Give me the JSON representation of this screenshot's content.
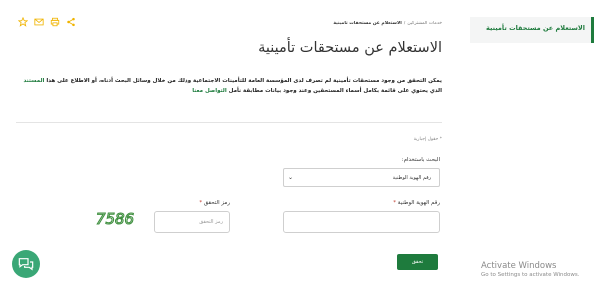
{
  "side_nav": {
    "active_item": "الاستعلام عن مستحقات تأمينية"
  },
  "breadcrumb": {
    "parent": "خدمات المشتركين",
    "separator": "/",
    "current": "الاستعلام عن مستحقات تأمينية"
  },
  "toolbar": {
    "icons": [
      "star-icon",
      "email-icon",
      "print-icon",
      "share-icon"
    ],
    "accent_color": "#f0b400"
  },
  "page": {
    "title": "الاستعلام عن مستحقات تأمينية",
    "description_part1": "يمكن التحقق من وجود مستحقات تأمينية لم تصرف لدى المؤسسة العامة للتأمينات الاجتماعية وذلك من خلال وسائل البحث أدناه، أو الاطلاع على هذا",
    "description_link1": "المستند",
    "description_part2": "الذي يحتوي على قائمة بكامل أسماء المستحقين وعند وجود بيانات مطابقة نأمل",
    "description_link2": "التواصل معنا"
  },
  "form": {
    "required_note": "* حقول إجبارية",
    "search_by_label": "البحث باستخدام:",
    "search_by_selected": "رقم الهوية الوطنية",
    "national_id_label": "رقم الهوية الوطنية",
    "national_id_value": "",
    "captcha_label": "رمز التحقق",
    "captcha_value": "",
    "captcha_placeholder": "رمز التحقق",
    "captcha_text": "7586",
    "submit_label": "تحقق"
  },
  "watermark": {
    "title": "Activate Windows",
    "subtitle": "Go to Settings to activate Windows."
  },
  "colors": {
    "brand_green": "#1e7b3d",
    "chat_green": "#3aa776",
    "required_red": "#c0392b"
  }
}
